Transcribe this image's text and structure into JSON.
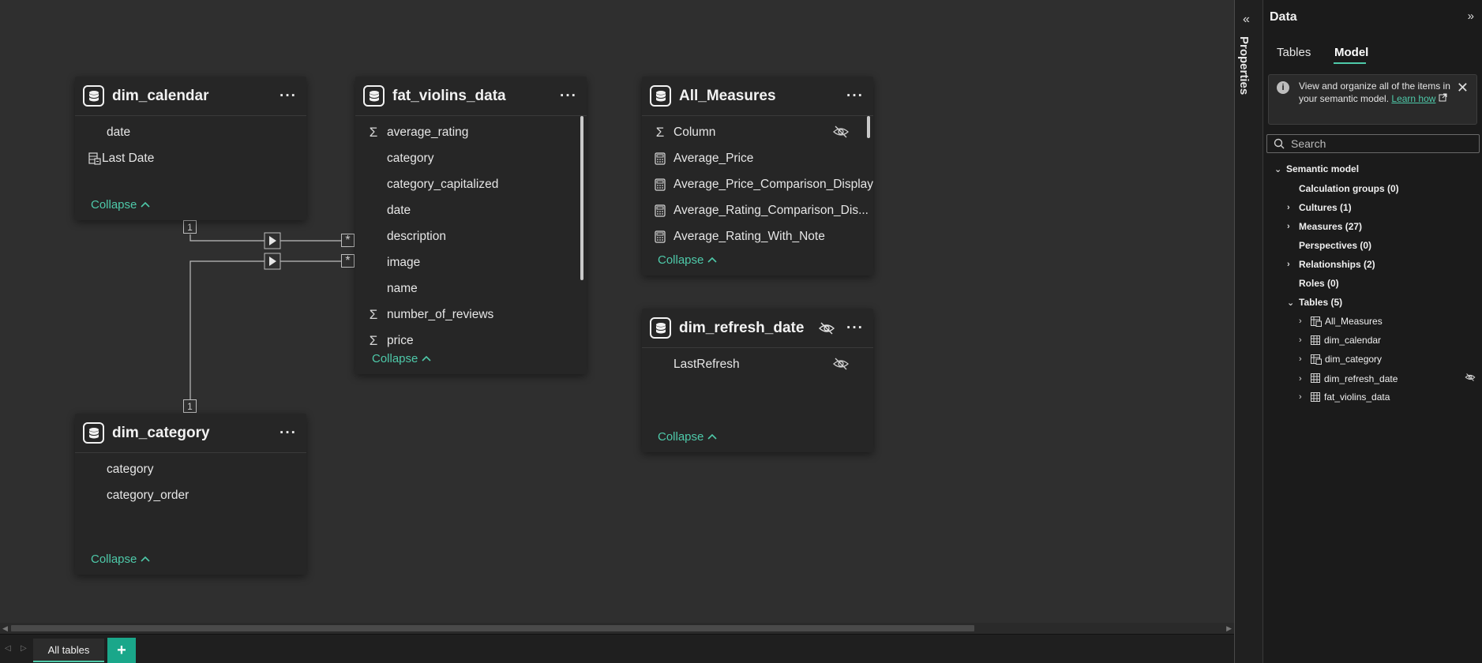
{
  "model_view": {
    "tables": [
      {
        "id": "dim_calendar",
        "title": "dim_calendar",
        "more_label": "···",
        "fields": [
          {
            "label": "date",
            "icon": "none"
          },
          {
            "label": "Last Date",
            "icon": "calculated-column-icon"
          }
        ],
        "collapse_label": "Collapse"
      },
      {
        "id": "fat_violins_data",
        "title": "fat_violins_data",
        "more_label": "···",
        "fields": [
          {
            "label": "average_rating",
            "icon": "sigma-icon"
          },
          {
            "label": "category",
            "icon": "none"
          },
          {
            "label": "category_capitalized",
            "icon": "none"
          },
          {
            "label": "date",
            "icon": "none"
          },
          {
            "label": "description",
            "icon": "none"
          },
          {
            "label": "image",
            "icon": "none"
          },
          {
            "label": "name",
            "icon": "none"
          },
          {
            "label": "number_of_reviews",
            "icon": "sigma-icon"
          },
          {
            "label": "price",
            "icon": "sigma-icon"
          }
        ],
        "collapse_label": "Collapse"
      },
      {
        "id": "All_Measures",
        "title": "All_Measures",
        "more_label": "···",
        "fields": [
          {
            "label": "Column",
            "icon": "sigma-icon",
            "hidden": true
          },
          {
            "label": "Average_Price",
            "icon": "calculator-icon"
          },
          {
            "label": "Average_Price_Comparison_Display",
            "icon": "calculator-icon"
          },
          {
            "label": "Average_Rating_Comparison_Dis...",
            "icon": "calculator-icon"
          },
          {
            "label": "Average_Rating_With_Note",
            "icon": "calculator-icon"
          }
        ],
        "collapse_label": "Collapse"
      },
      {
        "id": "dim_refresh_date",
        "title": "dim_refresh_date",
        "more_label": "···",
        "hidden": true,
        "fields": [
          {
            "label": "LastRefresh",
            "icon": "none",
            "hidden": true
          }
        ],
        "collapse_label": "Collapse"
      },
      {
        "id": "dim_category",
        "title": "dim_category",
        "more_label": "···",
        "fields": [
          {
            "label": "category",
            "icon": "none"
          },
          {
            "label": "category_order",
            "icon": "none"
          }
        ],
        "collapse_label": "Collapse"
      }
    ],
    "relationships": {
      "one_label": "1",
      "many_label": "*"
    }
  },
  "bottom_bar": {
    "tab_label": "All tables",
    "add_label": "+"
  },
  "properties_rail": {
    "label": "Properties"
  },
  "data_pane": {
    "title": "Data",
    "tabs": [
      "Tables",
      "Model"
    ],
    "active_tab": "Model",
    "info": {
      "text": "View and organize all of the items in your semantic model.",
      "link": "Learn how"
    },
    "search_placeholder": "Search",
    "tree": {
      "root": "Semantic model",
      "items": [
        {
          "label": "Calculation groups (0)",
          "expandable": false
        },
        {
          "label": "Cultures (1)",
          "expandable": true
        },
        {
          "label": "Measures (27)",
          "expandable": true
        },
        {
          "label": "Perspectives (0)",
          "expandable": false
        },
        {
          "label": "Relationships (2)",
          "expandable": true
        },
        {
          "label": "Roles (0)",
          "expandable": false
        },
        {
          "label": "Tables (5)",
          "expandable": true,
          "expanded": true
        }
      ],
      "tables": [
        {
          "label": "All_Measures",
          "icon": "measure-table-icon"
        },
        {
          "label": "dim_calendar",
          "icon": "table-icon"
        },
        {
          "label": "dim_category",
          "icon": "measure-table-icon"
        },
        {
          "label": "dim_refresh_date",
          "icon": "table-icon",
          "hidden": true
        },
        {
          "label": "fat_violins_data",
          "icon": "table-icon"
        }
      ]
    }
  },
  "colors": {
    "accent": "#4ec9a9",
    "canvas": "#2f2f2f",
    "card": "#262626",
    "pane": "#1b1b1b"
  }
}
